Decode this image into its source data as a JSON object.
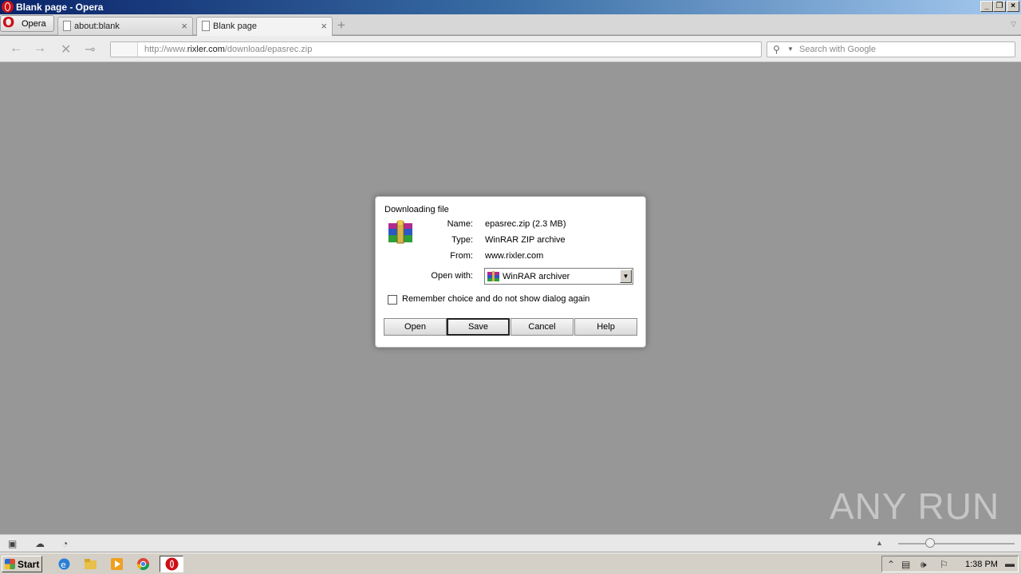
{
  "window": {
    "title": "Blank page - Opera"
  },
  "tabbar": {
    "opera_label": "Opera",
    "tabs": [
      {
        "label": "about:blank",
        "active": false
      },
      {
        "label": "Blank page",
        "active": true
      }
    ]
  },
  "navbar": {
    "url_prefix": "http://www.",
    "url_host": "rixler.com",
    "url_path": "/download/epasrec.zip",
    "search_placeholder": "Search with Google"
  },
  "dialog": {
    "title": "Downloading file",
    "name_label": "Name:",
    "name_value": "epasrec.zip (2.3 MB)",
    "type_label": "Type:",
    "type_value": "WinRAR ZIP archive",
    "from_label": "From:",
    "from_value": "www.rixler.com",
    "open_with_label": "Open with:",
    "open_with_value": "WinRAR archiver",
    "remember_label": "Remember choice and do not show dialog again",
    "remember_checked": false,
    "buttons": {
      "open": "Open",
      "save": "Save",
      "cancel": "Cancel",
      "help": "Help"
    }
  },
  "watermark": "ANY RUN",
  "taskbar": {
    "start_label": "Start",
    "clock": "1:38 PM"
  },
  "colors": {
    "page_background": "#979797",
    "opera_red": "#cc0f16",
    "titlebar_start": "#0a246a"
  }
}
